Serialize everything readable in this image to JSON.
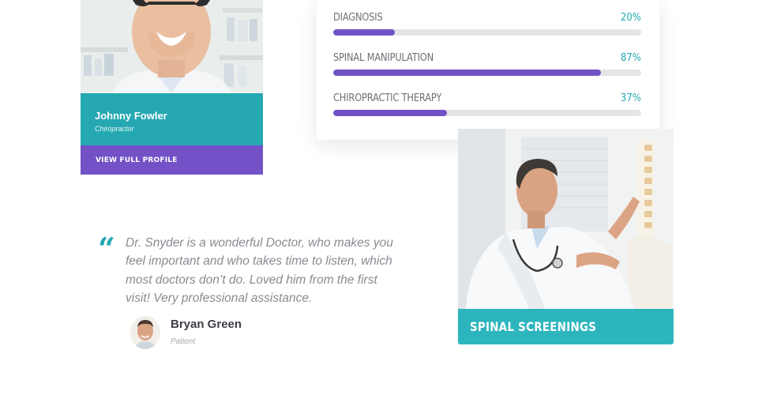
{
  "doctor_card": {
    "name": "Johnny Fowler",
    "role": "Chiropractor",
    "link_label": "VIEW FULL PROFILE",
    "colors": {
      "info_bg": "#25a8b2",
      "link_bg": "#7252c6"
    }
  },
  "skills": {
    "items": [
      {
        "label": "DIAGNOSIS",
        "value_text": "20%",
        "percent": 20
      },
      {
        "label": "SPINAL MANIPULATION",
        "value_text": "87%",
        "percent": 87
      },
      {
        "label": "CHIROPRACTIC THERAPY",
        "value_text": "37%",
        "percent": 37
      }
    ],
    "colors": {
      "bar": "#7252c6",
      "track": "#e5e5e7",
      "value": "#25a8b2"
    }
  },
  "testimonial": {
    "quote_icon": "quote-icon",
    "quote_glyph": "“",
    "text": "Dr. Snyder is a wonderful Doctor, who makes you feel important and who takes time to listen, which most doctors don’t do. Loved him from the first visit! Very professional assistance.",
    "author_name": "Bryan Green",
    "author_role": "Patient"
  },
  "service_card": {
    "title": "SPINAL SCREENINGS",
    "colors": {
      "label_bg": "#2db5be"
    }
  }
}
